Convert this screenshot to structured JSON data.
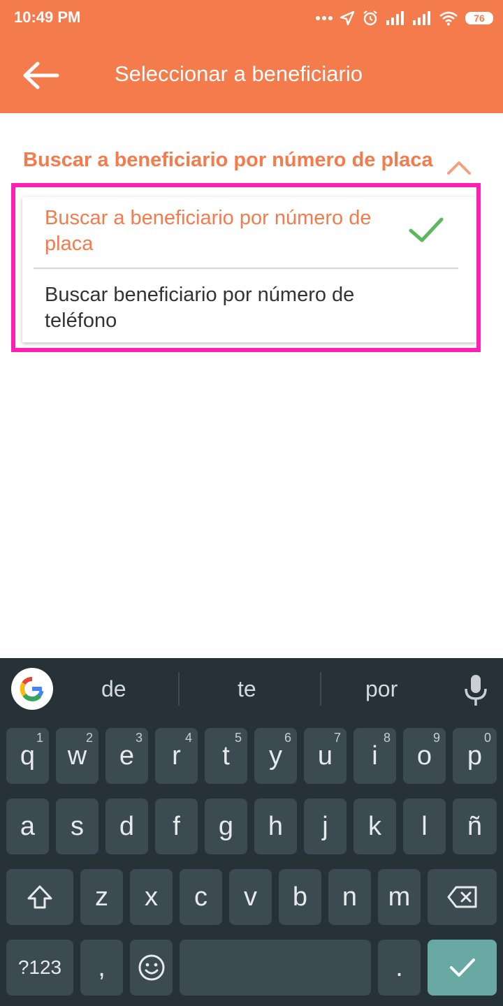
{
  "status_bar": {
    "time": "10:49 PM",
    "battery": "76"
  },
  "header": {
    "title": "Seleccionar a beneficiario"
  },
  "selector": {
    "heading": "Buscar a beneficiario por número de placa",
    "options": [
      {
        "label": "Buscar a beneficiario por número de placa",
        "selected": true
      },
      {
        "label": "Buscar beneficiario por número de teléfono",
        "selected": false
      }
    ]
  },
  "keyboard": {
    "suggestions": [
      "de",
      "te",
      "por"
    ],
    "row1": [
      {
        "label": "q",
        "hint": "1"
      },
      {
        "label": "w",
        "hint": "2"
      },
      {
        "label": "e",
        "hint": "3"
      },
      {
        "label": "r",
        "hint": "4"
      },
      {
        "label": "t",
        "hint": "5"
      },
      {
        "label": "y",
        "hint": "6"
      },
      {
        "label": "u",
        "hint": "7"
      },
      {
        "label": "i",
        "hint": "8"
      },
      {
        "label": "o",
        "hint": "9"
      },
      {
        "label": "p",
        "hint": "0"
      }
    ],
    "row2": [
      "a",
      "s",
      "d",
      "f",
      "g",
      "h",
      "j",
      "k",
      "l",
      "ñ"
    ],
    "row3": [
      "z",
      "x",
      "c",
      "v",
      "b",
      "n",
      "m"
    ],
    "sym_label": "?123",
    "comma_label": ",",
    "period_label": "."
  },
  "colors": {
    "accent": "#f47b4c",
    "highlight": "#ff1fb4",
    "check": "#5cb85c",
    "keyboard_bg": "#263238"
  }
}
